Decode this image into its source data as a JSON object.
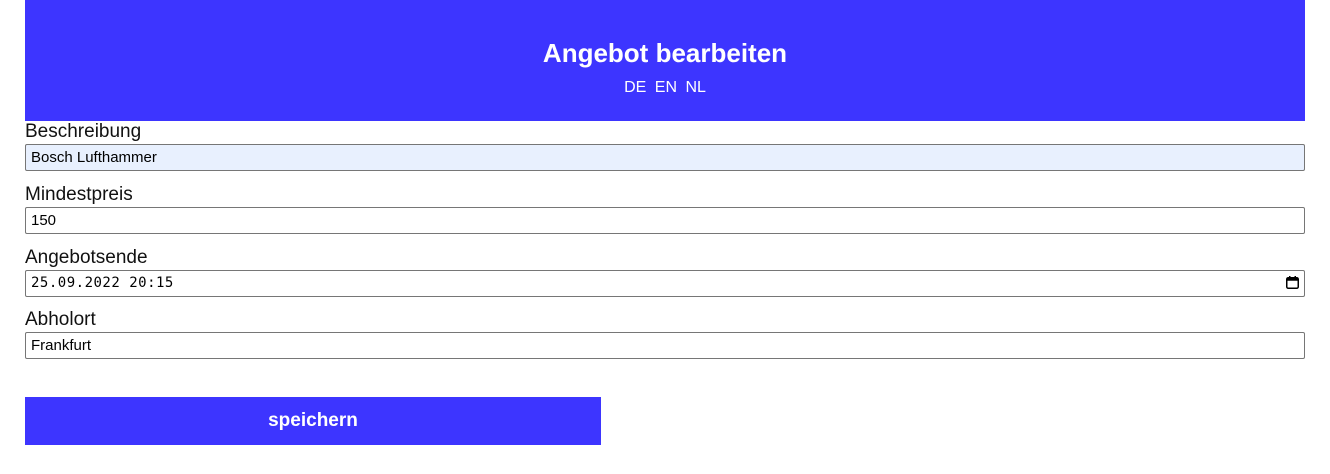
{
  "header": {
    "title": "Angebot bearbeiten",
    "languages": [
      "DE",
      "EN",
      "NL"
    ]
  },
  "form": {
    "description": {
      "label": "Beschreibung",
      "value": "Bosch Lufthammer"
    },
    "min_price": {
      "label": "Mindestpreis",
      "value": "150"
    },
    "offer_end": {
      "label": "Angebotsende",
      "value": "25.09.2022 20:15"
    },
    "pickup": {
      "label": "Abholort",
      "value": "Frankfurt"
    },
    "save_label": "speichern"
  },
  "colors": {
    "accent": "#3d35ff",
    "autofill_bg": "#e8f0fe"
  }
}
